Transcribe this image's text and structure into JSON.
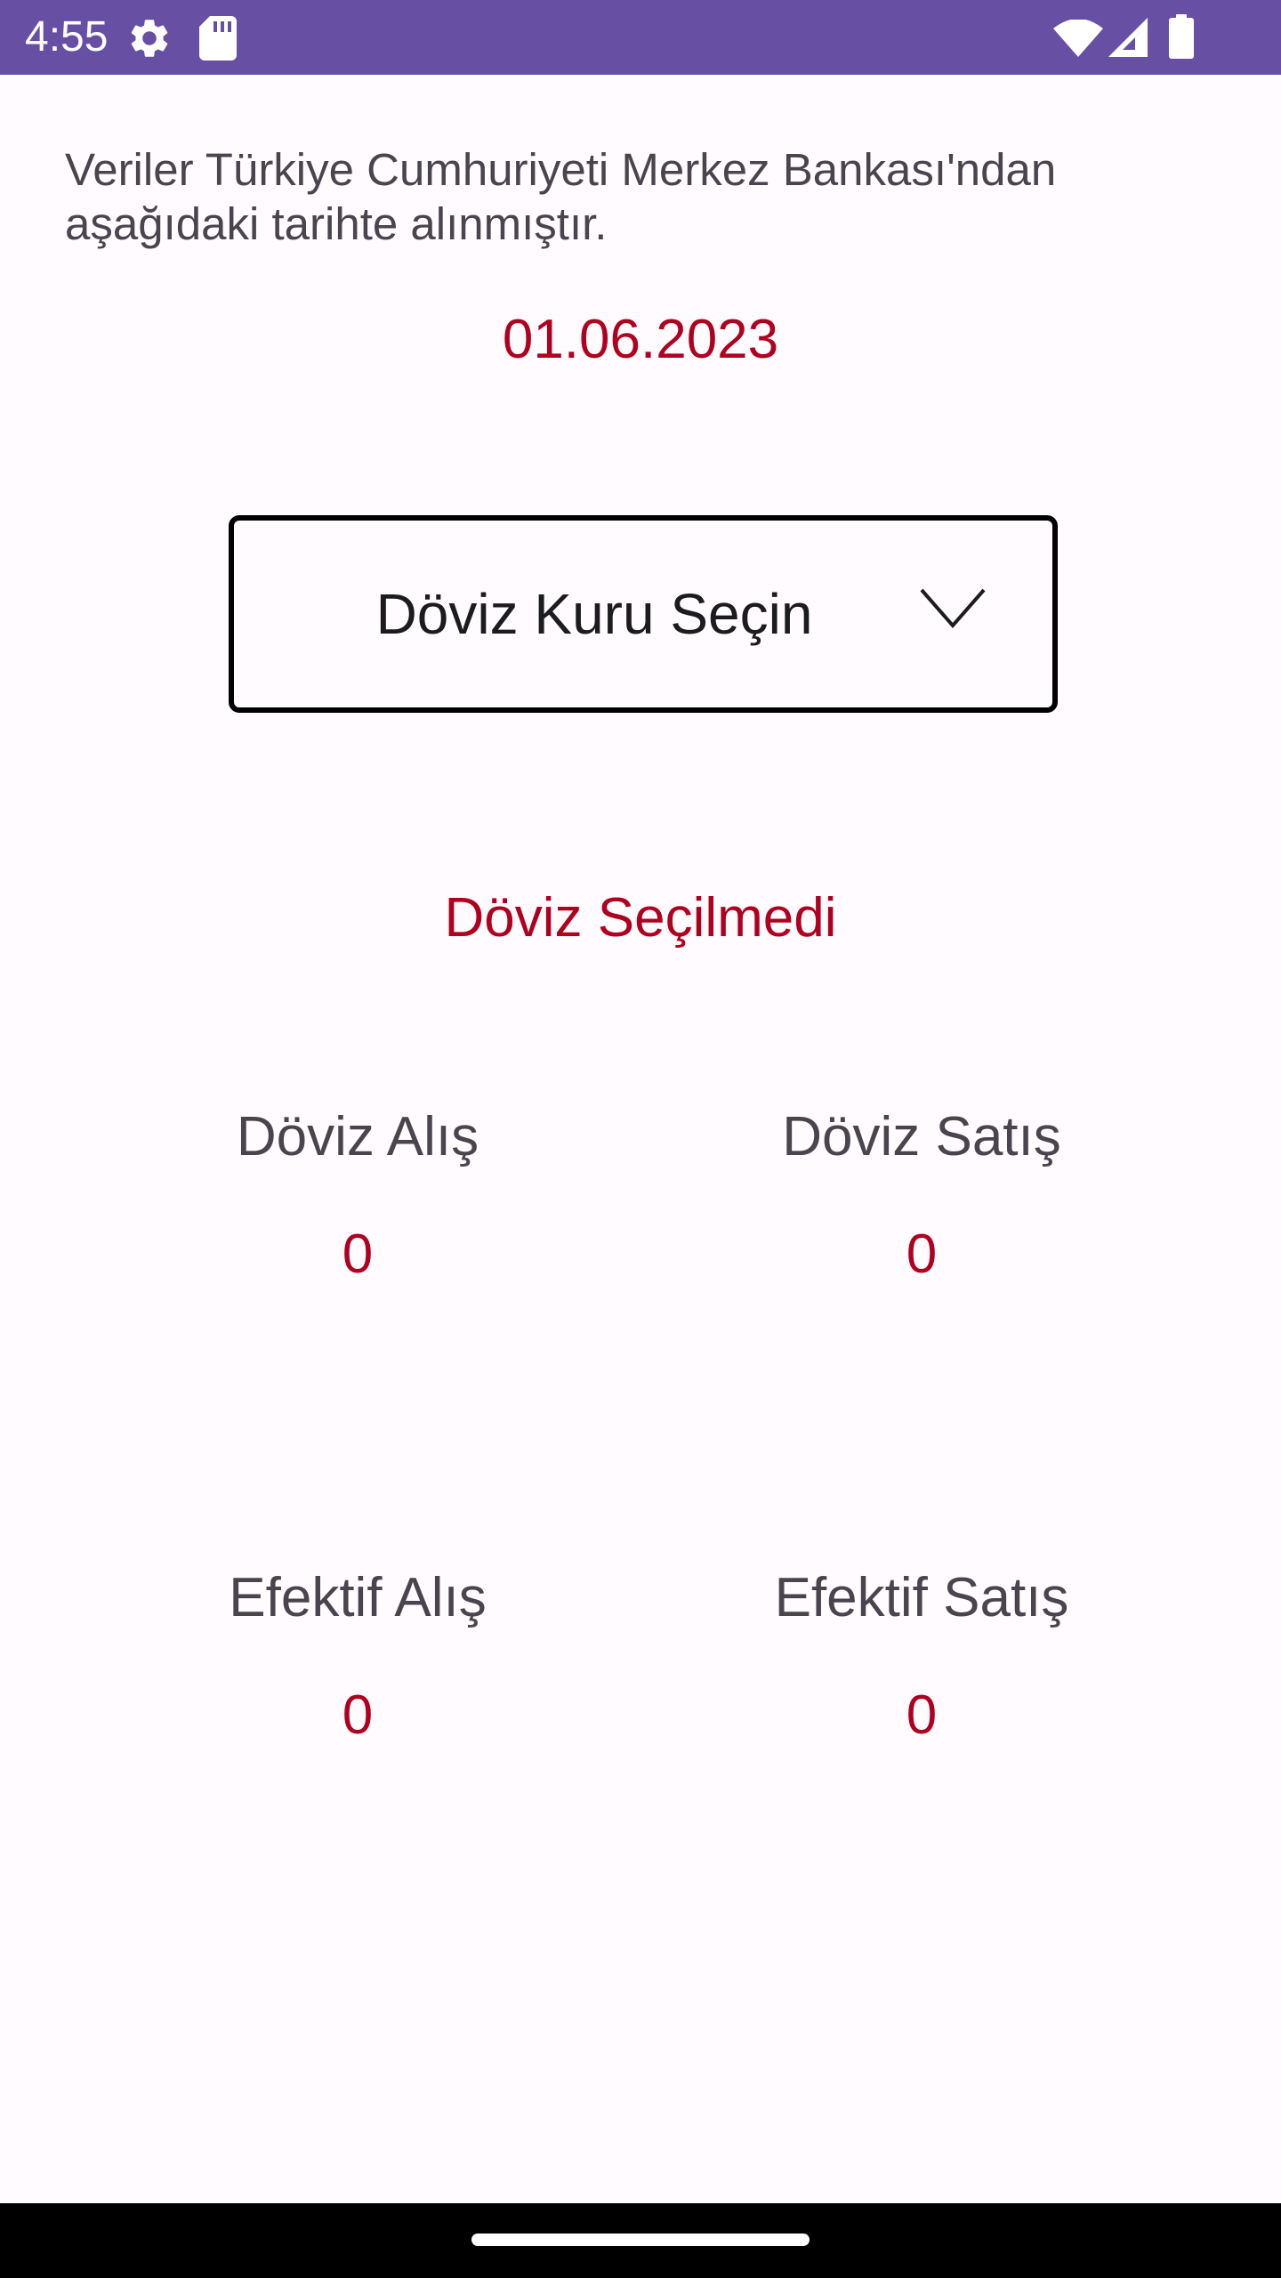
{
  "status_bar": {
    "time": "4:55",
    "background": "#6750a4",
    "icons": [
      "settings-icon",
      "sd-card-icon",
      "wifi-icon",
      "signal-icon",
      "battery-icon"
    ]
  },
  "source": {
    "line1": "Veriler Türkiye Cumhuriyeti Merkez Bankası'ndan",
    "line2": "aşağıdaki tarihte alınmıştır."
  },
  "date": "01.06.2023",
  "currency_select": {
    "selected": "Döviz Kuru Seçin",
    "icon": "chevron-down-icon"
  },
  "selection_status": "Döviz Seçilmedi",
  "rates": {
    "forex_buy": {
      "label": "Döviz Alış",
      "value": "0"
    },
    "forex_sell": {
      "label": "Döviz Satış",
      "value": "0"
    },
    "banknote_buy": {
      "label": "Efektif Alış",
      "value": "0"
    },
    "banknote_sell": {
      "label": "Efektif Satış",
      "value": "0"
    }
  },
  "colors": {
    "accent_red": "#b00020",
    "primary_purple": "#6750a4",
    "label_gray": "#49454f",
    "background": "#fffbfe"
  }
}
